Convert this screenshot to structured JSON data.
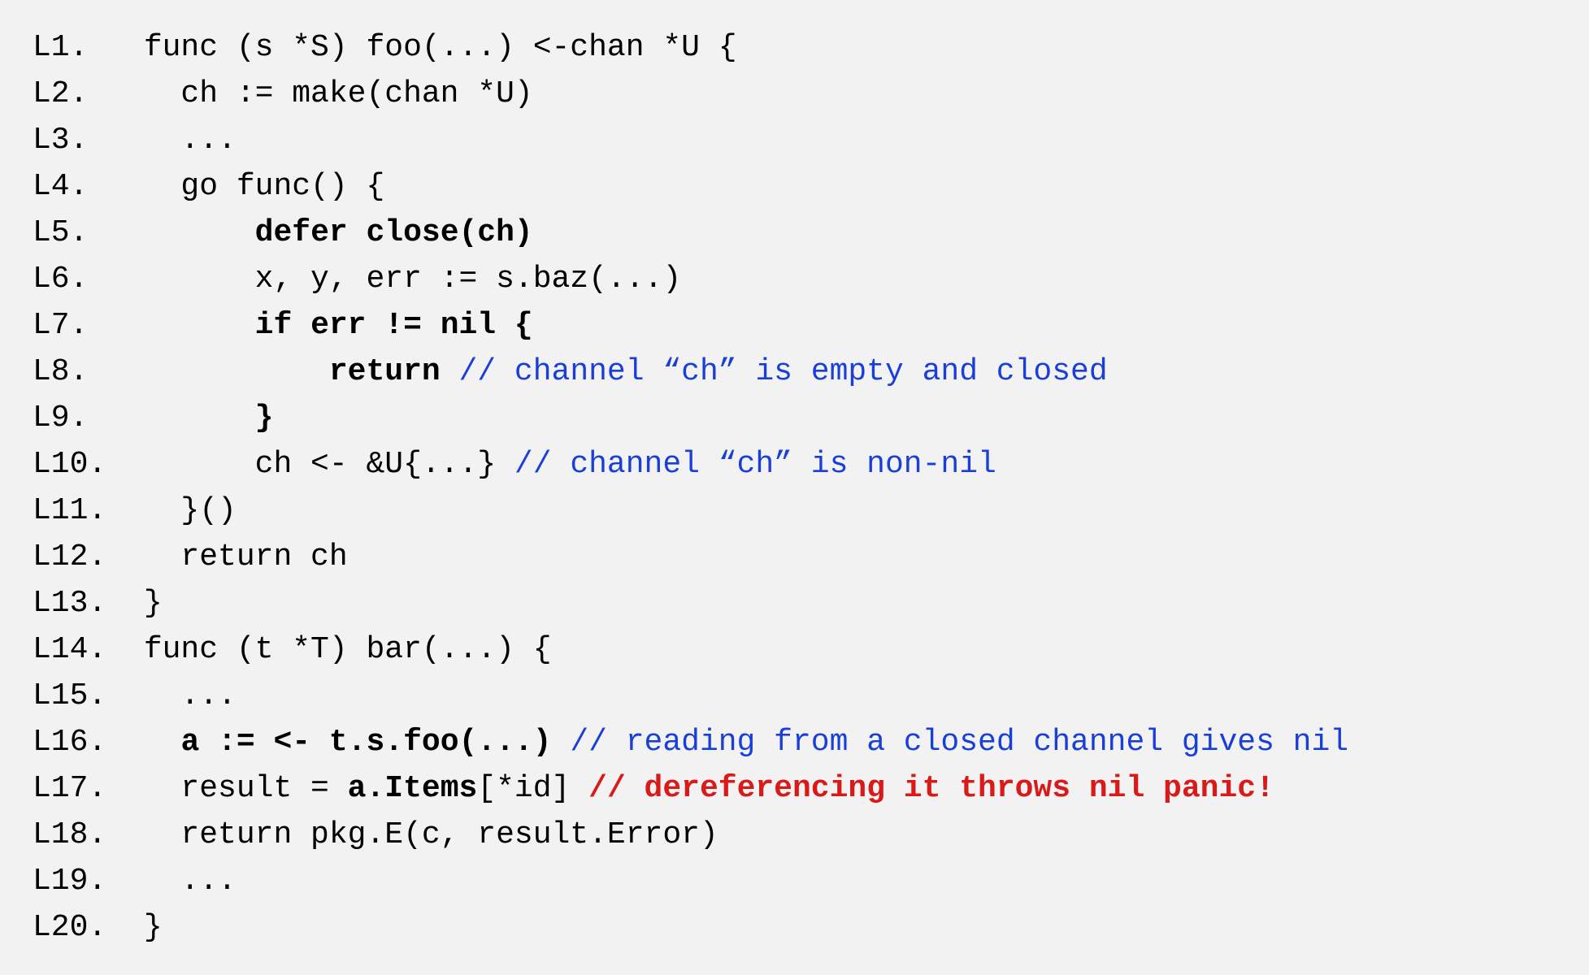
{
  "code": {
    "lines": [
      {
        "num": "L1.",
        "segments": [
          {
            "text": " func (s *S) foo(...) <-chan *U {"
          }
        ]
      },
      {
        "num": "L2.",
        "segments": [
          {
            "text": "   ch := make(chan *U)"
          }
        ]
      },
      {
        "num": "L3.",
        "segments": [
          {
            "text": "   ..."
          }
        ]
      },
      {
        "num": "L4.",
        "segments": [
          {
            "text": "   go func() {"
          }
        ]
      },
      {
        "num": "L5.",
        "segments": [
          {
            "text": "       "
          },
          {
            "text": "defer close(ch)",
            "bold": true
          }
        ]
      },
      {
        "num": "L6.",
        "segments": [
          {
            "text": "       x, y, err := s.baz(...)"
          }
        ]
      },
      {
        "num": "L7.",
        "segments": [
          {
            "text": "       "
          },
          {
            "text": "if err != nil {",
            "bold": true
          }
        ]
      },
      {
        "num": "L8.",
        "segments": [
          {
            "text": "           "
          },
          {
            "text": "return",
            "bold": true
          },
          {
            "text": " "
          },
          {
            "text": "// channel “ch” is empty and closed",
            "color": "blue"
          }
        ]
      },
      {
        "num": "L9.",
        "segments": [
          {
            "text": "       "
          },
          {
            "text": "}",
            "bold": true
          }
        ]
      },
      {
        "num": "L10.",
        "segments": [
          {
            "text": "       ch <- &U{...} "
          },
          {
            "text": "// channel “ch” is non-nil",
            "color": "blue"
          }
        ]
      },
      {
        "num": "L11.",
        "segments": [
          {
            "text": "   }()"
          }
        ]
      },
      {
        "num": "L12.",
        "segments": [
          {
            "text": "   return ch"
          }
        ]
      },
      {
        "num": "L13.",
        "segments": [
          {
            "text": " }"
          }
        ]
      },
      {
        "num": "L14.",
        "segments": [
          {
            "text": " func (t *T) bar(...) {"
          }
        ]
      },
      {
        "num": "L15.",
        "segments": [
          {
            "text": "   ..."
          }
        ]
      },
      {
        "num": "L16.",
        "segments": [
          {
            "text": "   "
          },
          {
            "text": "a := <- t.s.foo(...)",
            "bold": true
          },
          {
            "text": " "
          },
          {
            "text": "// reading from a closed channel gives nil",
            "color": "blue"
          }
        ]
      },
      {
        "num": "L17.",
        "segments": [
          {
            "text": "   result = "
          },
          {
            "text": "a.Items",
            "bold": true
          },
          {
            "text": "[*id] "
          },
          {
            "text": "// dereferencing it throws nil panic!",
            "color": "red",
            "bold": true
          }
        ]
      },
      {
        "num": "L18.",
        "segments": [
          {
            "text": "   return pkg.E(c, result.Error)"
          }
        ]
      },
      {
        "num": "L19.",
        "segments": [
          {
            "text": "   ..."
          }
        ]
      },
      {
        "num": "L20.",
        "segments": [
          {
            "text": " }"
          }
        ]
      }
    ]
  }
}
